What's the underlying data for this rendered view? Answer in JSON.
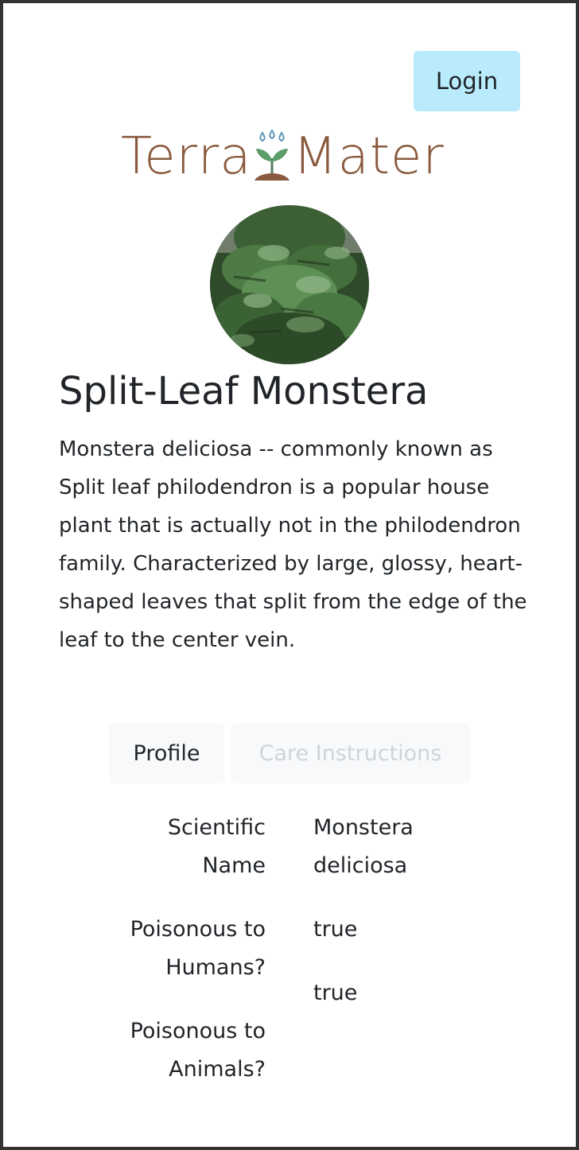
{
  "header": {
    "login_label": "Login"
  },
  "logo": {
    "word_left": "Terra",
    "word_right": "Mater",
    "icon": "sprout-icon",
    "color": "#8a5a3e"
  },
  "plant": {
    "title": "Split-Leaf Monstera",
    "description": "Monstera deliciosa -- commonly known as Split leaf philodendron is a popular house plant that is actually not in the philodendron family. Characterized by large, glossy, heart-shaped leaves that split from the edge of the leaf to the center vein."
  },
  "tabs": [
    {
      "label": "Profile",
      "active": true
    },
    {
      "label": "Care Instructions",
      "active": false
    }
  ],
  "profile": {
    "rows": [
      {
        "label_line1": "Scientific",
        "label_line2": "Name",
        "value_line1": "Monstera",
        "value_line2": "deliciosa"
      },
      {
        "label_line1": "Poisonous to",
        "label_line2": "Humans?",
        "value": "true"
      },
      {
        "label_line1": "Poisonous to",
        "label_line2": "Animals?",
        "value": "true"
      }
    ]
  },
  "colors": {
    "login_bg": "#b9ebfc",
    "tab_bg": "#f8f9fa",
    "inactive_tab_text": "#ced4da",
    "text": "#212529",
    "frame": "#333333"
  }
}
